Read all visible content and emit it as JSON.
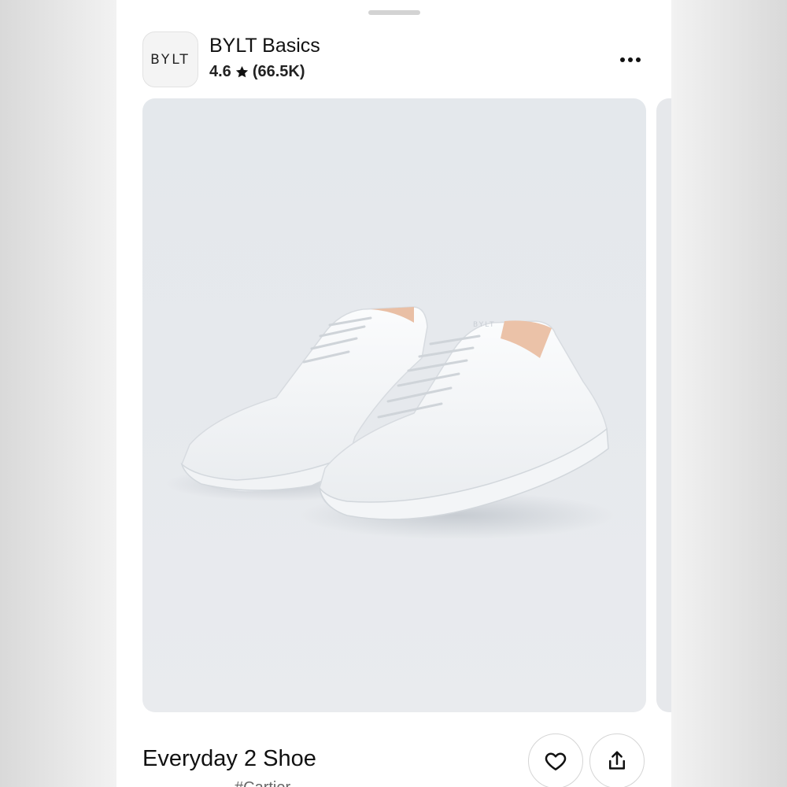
{
  "shop": {
    "logo_text": "BYLT",
    "name": "BYLT Basics",
    "rating": "4.6",
    "review_count": "(66.5K)"
  },
  "product": {
    "title": "Everyday 2 Shoe",
    "subtitle": "#Cartier"
  },
  "colors": {
    "sheet_bg": "#ffffff",
    "media_bg": "#e6e9ed",
    "text_primary": "#111111"
  },
  "icons": {
    "rating": "star-icon",
    "menu": "more-horizontal-icon",
    "favorite": "heart-icon",
    "share": "share-icon"
  }
}
